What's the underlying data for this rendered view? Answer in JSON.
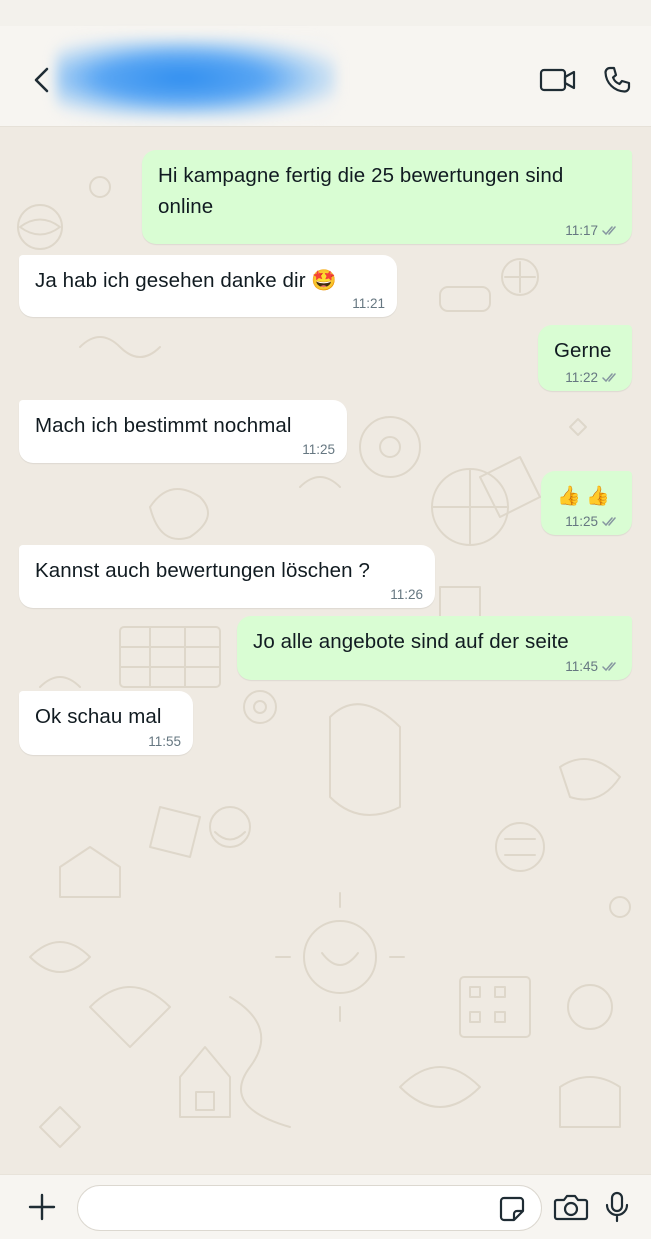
{
  "header": {
    "contact_name": "",
    "icons": [
      "back-arrow-icon",
      "video-call-icon",
      "voice-call-icon"
    ]
  },
  "messages": [
    {
      "direction": "out",
      "text": "Hi kampagne fertig die 25 bewertungen sind online",
      "time": "11:17",
      "status": "read"
    },
    {
      "direction": "in",
      "text": "Ja hab ich gesehen danke dir 🤩",
      "time": "11:21"
    },
    {
      "direction": "out",
      "text": "Gerne",
      "time": "11:22",
      "status": "read"
    },
    {
      "direction": "in",
      "text": "Mach ich bestimmt nochmal",
      "time": "11:25"
    },
    {
      "direction": "out",
      "text": "👍 👍",
      "time": "11:25",
      "status": "read"
    },
    {
      "direction": "in",
      "text": "Kannst auch bewertungen löschen ?",
      "time": "11:26"
    },
    {
      "direction": "out",
      "text": "Jo alle angebote sind auf der seite",
      "time": "11:45",
      "status": "read"
    },
    {
      "direction": "in",
      "text": "Ok schau mal",
      "time": "11:55"
    }
  ],
  "composer": {
    "placeholder": "",
    "value": "",
    "icons": [
      "plus-icon",
      "sticker-icon",
      "camera-icon",
      "microphone-icon"
    ]
  },
  "colors": {
    "wallpaper": "#efeae2",
    "incoming_bubble": "#ffffff",
    "outgoing_bubble": "#d9fdd3",
    "text": "#111b21",
    "meta": "#667781"
  }
}
